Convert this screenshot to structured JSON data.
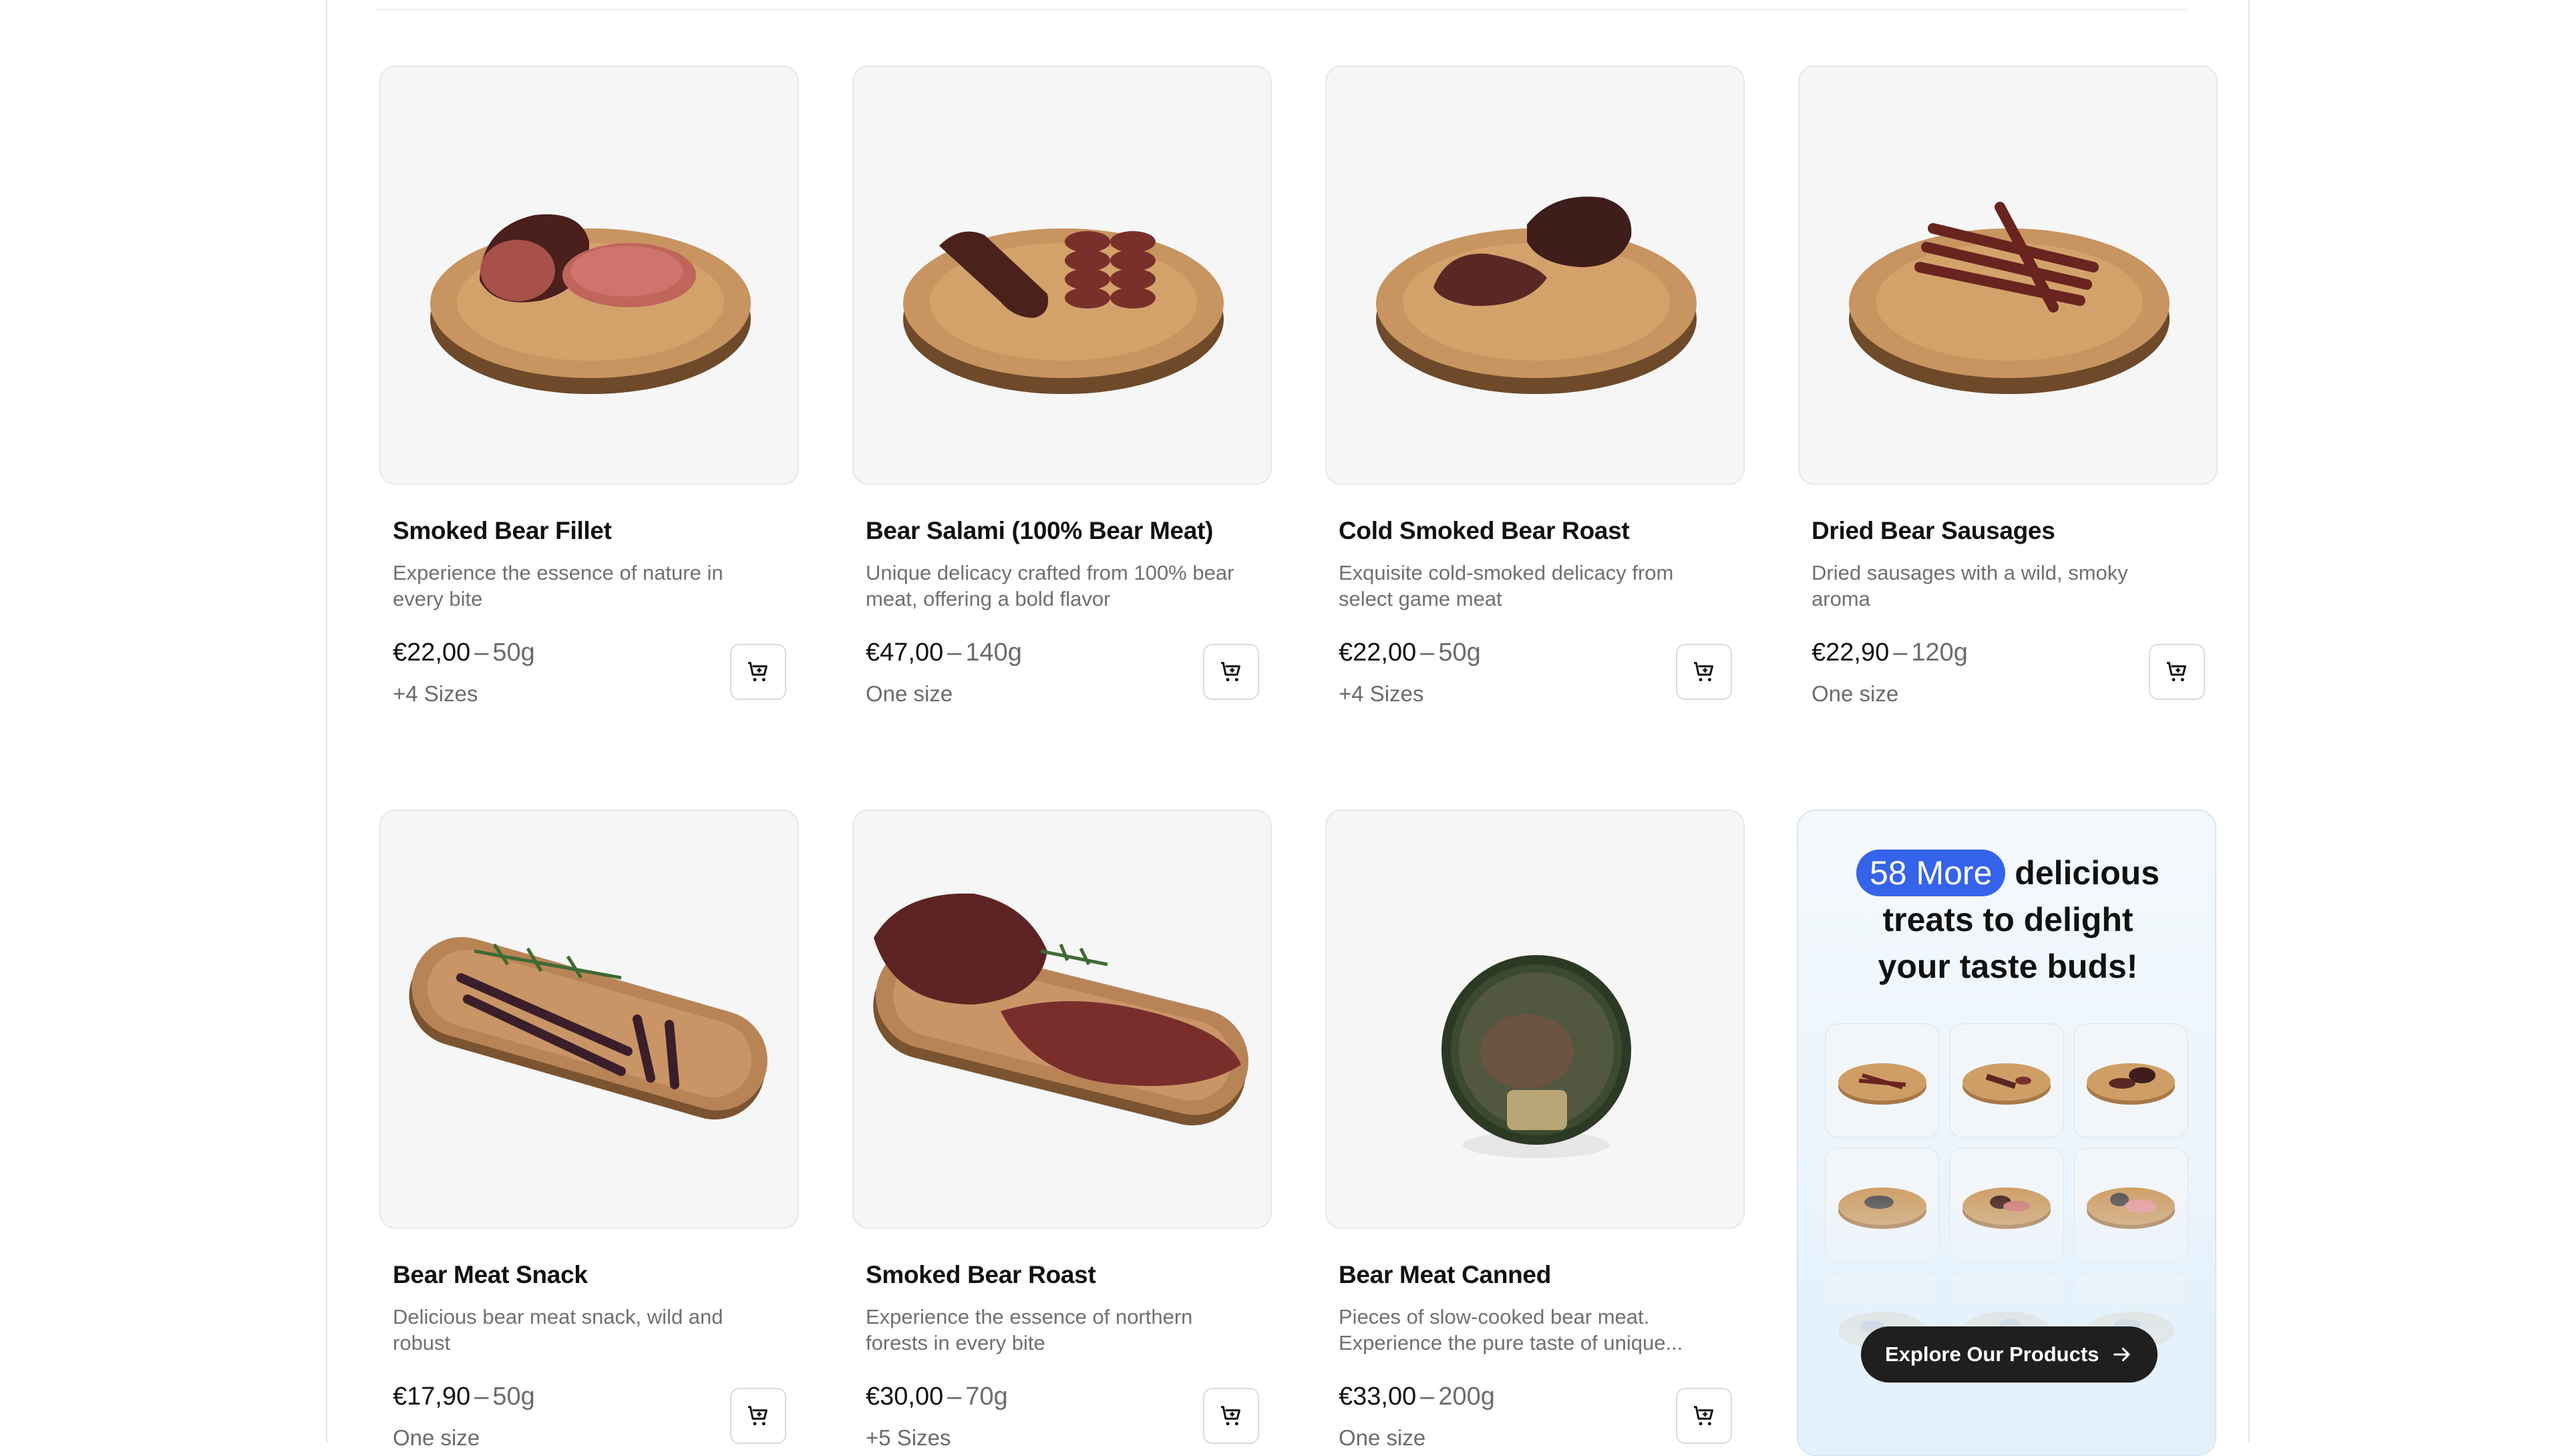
{
  "products": [
    {
      "name": "Smoked Bear Fillet",
      "desc": "Experience the essence of nature in every bite",
      "price": "€22,00",
      "weight": "50g",
      "sizes": "+4 Sizes",
      "image_icon": "board-fillet-icon"
    },
    {
      "name": "Bear Salami (100% Bear Meat)",
      "desc": "Unique delicacy crafted from 100% bear meat, offering a bold flavor",
      "price": "€47,00",
      "weight": "140g",
      "sizes": "One size",
      "image_icon": "board-salami-icon"
    },
    {
      "name": "Cold Smoked Bear Roast",
      "desc": "Exquisite cold-smoked delicacy from select game meat",
      "price": "€22,00",
      "weight": "50g",
      "sizes": "+4 Sizes",
      "image_icon": "board-roast-icon"
    },
    {
      "name": "Dried Bear Sausages",
      "desc": "Dried sausages with a wild, smoky aroma",
      "price": "€22,90",
      "weight": "120g",
      "sizes": "One size",
      "image_icon": "board-sausages-icon"
    },
    {
      "name": "Bear Meat Snack",
      "desc": "Delicious bear meat snack, wild and robust",
      "price": "€17,90",
      "weight": "50g",
      "sizes": "One size",
      "image_icon": "tray-snack-icon"
    },
    {
      "name": "Smoked Bear Roast",
      "desc": "Experience the essence of northern forests in every bite",
      "price": "€30,00",
      "weight": "70g",
      "sizes": "+5 Sizes",
      "image_icon": "tray-roast-icon"
    },
    {
      "name": "Bear Meat Canned",
      "desc": "Pieces of slow-cooked bear meat. Experience the pure taste of unique...",
      "price": "€33,00",
      "weight": "200g",
      "sizes": "One size",
      "image_icon": "can-icon"
    }
  ],
  "dash": "–",
  "promo": {
    "count": "58 More",
    "line1_rest": "delicious",
    "line2": "treats to delight",
    "line3": "your taste buds!",
    "button": "Explore Our Products"
  },
  "colors": {
    "accent": "#3563e9",
    "button_dark": "#1f1f1f",
    "wood": "#c08a4e"
  }
}
